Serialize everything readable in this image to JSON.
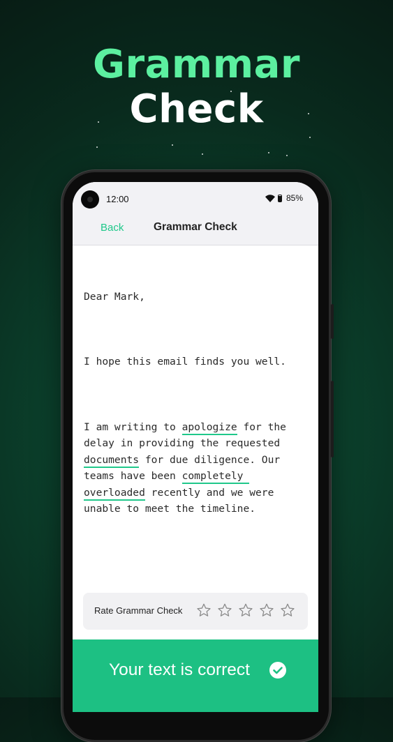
{
  "hero": {
    "line1": "Grammar",
    "line2": "Check",
    "line1_color": "#5cf0a0",
    "line2_color": "#ffffff"
  },
  "status_bar": {
    "time": "12:00",
    "battery": "85%",
    "icons": [
      "camera-icon",
      "wifi-icon",
      "battery-icon"
    ]
  },
  "nav": {
    "back_label": "Back",
    "title": "Grammar Check",
    "accent_color": "#1fc88a"
  },
  "document": {
    "greeting": "Dear Mark,",
    "line2": "I hope this email finds you well.",
    "p3_before": "I am writing to ",
    "p3_word1": "apologize",
    "p3_mid1": " for the delay in providing the requested ",
    "p3_word2": "documents",
    "p3_mid2": " for due diligence. Our teams have been ",
    "p3_word3": "completely overloaded",
    "p3_end": " recently and we were unable to meet the timeline."
  },
  "rating": {
    "label": "Rate Grammar Check",
    "max_stars": 5,
    "selected_stars": 0,
    "icon": "star-outline-icon"
  },
  "result": {
    "text": "Your text is correct",
    "icon": "check-circle-icon",
    "background_color": "#1dc083"
  }
}
